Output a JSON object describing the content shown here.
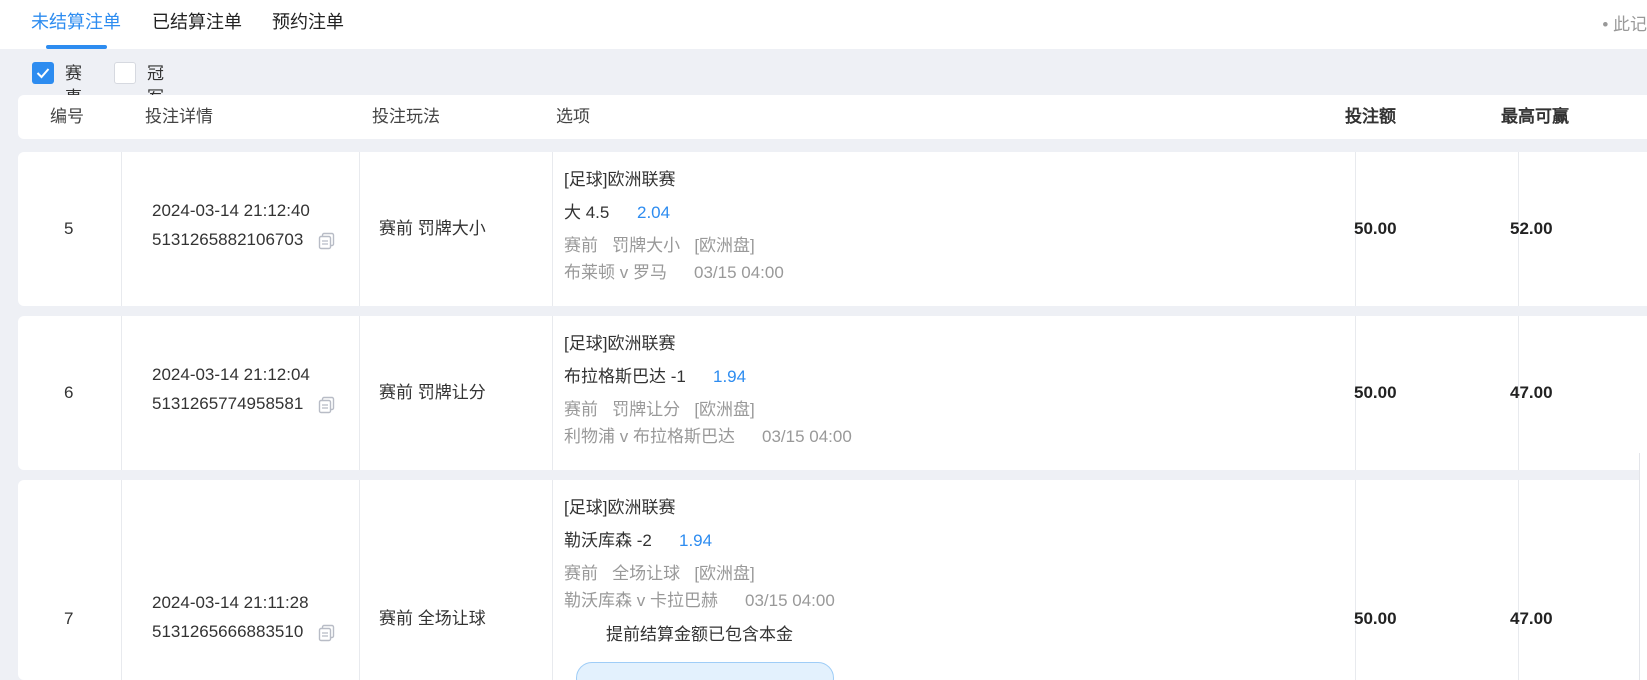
{
  "tabs": [
    {
      "label": "未结算注单"
    },
    {
      "label": "已结算注单"
    },
    {
      "label": "预约注单"
    }
  ],
  "note": "• 此记",
  "filters": [
    {
      "label": "赛事",
      "checked": true
    },
    {
      "label": "冠军",
      "checked": false
    }
  ],
  "columns": [
    "编号",
    "投注详情",
    "投注玩法",
    "选项",
    "投注额",
    "最高可赢"
  ],
  "rows": [
    {
      "id": "5",
      "datetime": "2024-03-14 21:12:40",
      "order_no": "5131265882106703",
      "play": "赛前 罚牌大小",
      "league": "[足球]欧洲联赛",
      "pick": "大 4.5",
      "odds": "2.04",
      "market": "赛前   罚牌大小   [欧洲盘]",
      "match": "布莱顿 v 罗马",
      "match_time": "03/15 04:00",
      "stake": "50.00",
      "max_win": "52.00"
    },
    {
      "id": "6",
      "datetime": "2024-03-14 21:12:04",
      "order_no": "5131265774958581",
      "play": "赛前 罚牌让分",
      "league": "[足球]欧洲联赛",
      "pick": "布拉格斯巴达 -1",
      "odds": "1.94",
      "market": "赛前   罚牌让分   [欧洲盘]",
      "match": "利物浦 v 布拉格斯巴达",
      "match_time": "03/15 04:00",
      "stake": "50.00",
      "max_win": "47.00"
    },
    {
      "id": "7",
      "datetime": "2024-03-14 21:11:28",
      "order_no": "5131265666883510",
      "play": "赛前 全场让球",
      "league": "[足球]欧洲联赛",
      "pick": "勒沃库森 -2",
      "odds": "1.94",
      "market": "赛前   全场让球   [欧洲盘]",
      "match": "勒沃库森 v 卡拉巴赫",
      "match_time": "03/15 04:00",
      "note": "提前结算金额已包含本金",
      "stake": "50.00",
      "max_win": "47.00"
    }
  ],
  "colors": {
    "accent": "#2d8cf0",
    "muted": "#999999",
    "background": "#eef0f5"
  },
  "icons": {
    "copy": "copy-icon",
    "check": "checkmark-icon"
  }
}
